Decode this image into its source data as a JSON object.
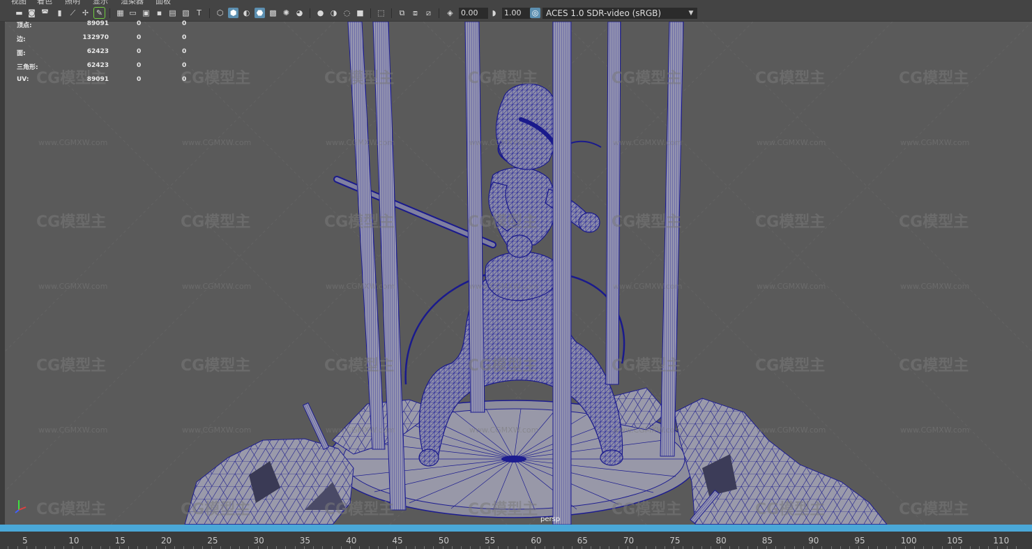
{
  "menus": [
    "视图",
    "着色",
    "照明",
    "显示",
    "渲染器",
    "面板"
  ],
  "toolbar": {
    "exposure_value": "0.00",
    "gamma_value": "1.00",
    "colorspace_label": "ACES 1.0 SDR-video (sRGB)",
    "icons": [
      "camera-select-icon",
      "camera-attributes-icon",
      "bookmark-icon",
      "image-plane-icon",
      "grease-pencil-icon",
      "grid-icon",
      "film-gate-icon",
      "resolution-gate-icon",
      "safe-action-icon",
      "field-chart-icon",
      "wireframe-icon",
      "smooth-shade-icon",
      "textured-icon",
      "lights-icon",
      "shadows-icon",
      "ao-icon",
      "isolate-icon",
      "xray-icon",
      "exposure-icon",
      "gamma-icon",
      "colorspace-icon"
    ]
  },
  "hud": {
    "rows": [
      {
        "label": "顶点:",
        "v1": "89091",
        "v2": "0",
        "v3": "0"
      },
      {
        "label": "边:",
        "v1": "132970",
        "v2": "0",
        "v3": "0"
      },
      {
        "label": "面:",
        "v1": "62423",
        "v2": "0",
        "v3": "0"
      },
      {
        "label": "三角形:",
        "v1": "62423",
        "v2": "0",
        "v3": "0"
      },
      {
        "label": "UV:",
        "v1": "89091",
        "v2": "0",
        "v3": "0"
      }
    ]
  },
  "viewport": {
    "camera_label": "persp",
    "watermark_logo": "CG模型主",
    "watermark_url": "www.CGMXW.com",
    "mesh_color": "#1a1a8c",
    "bg_color": "#5a5a5a"
  },
  "timeline": {
    "ticks": [
      "5",
      "10",
      "15",
      "20",
      "25",
      "30",
      "35",
      "40",
      "45",
      "50",
      "55",
      "60",
      "65",
      "70",
      "75",
      "80",
      "85",
      "90",
      "95",
      "100",
      "105",
      "110"
    ],
    "bar_color": "#4aa8d8"
  }
}
